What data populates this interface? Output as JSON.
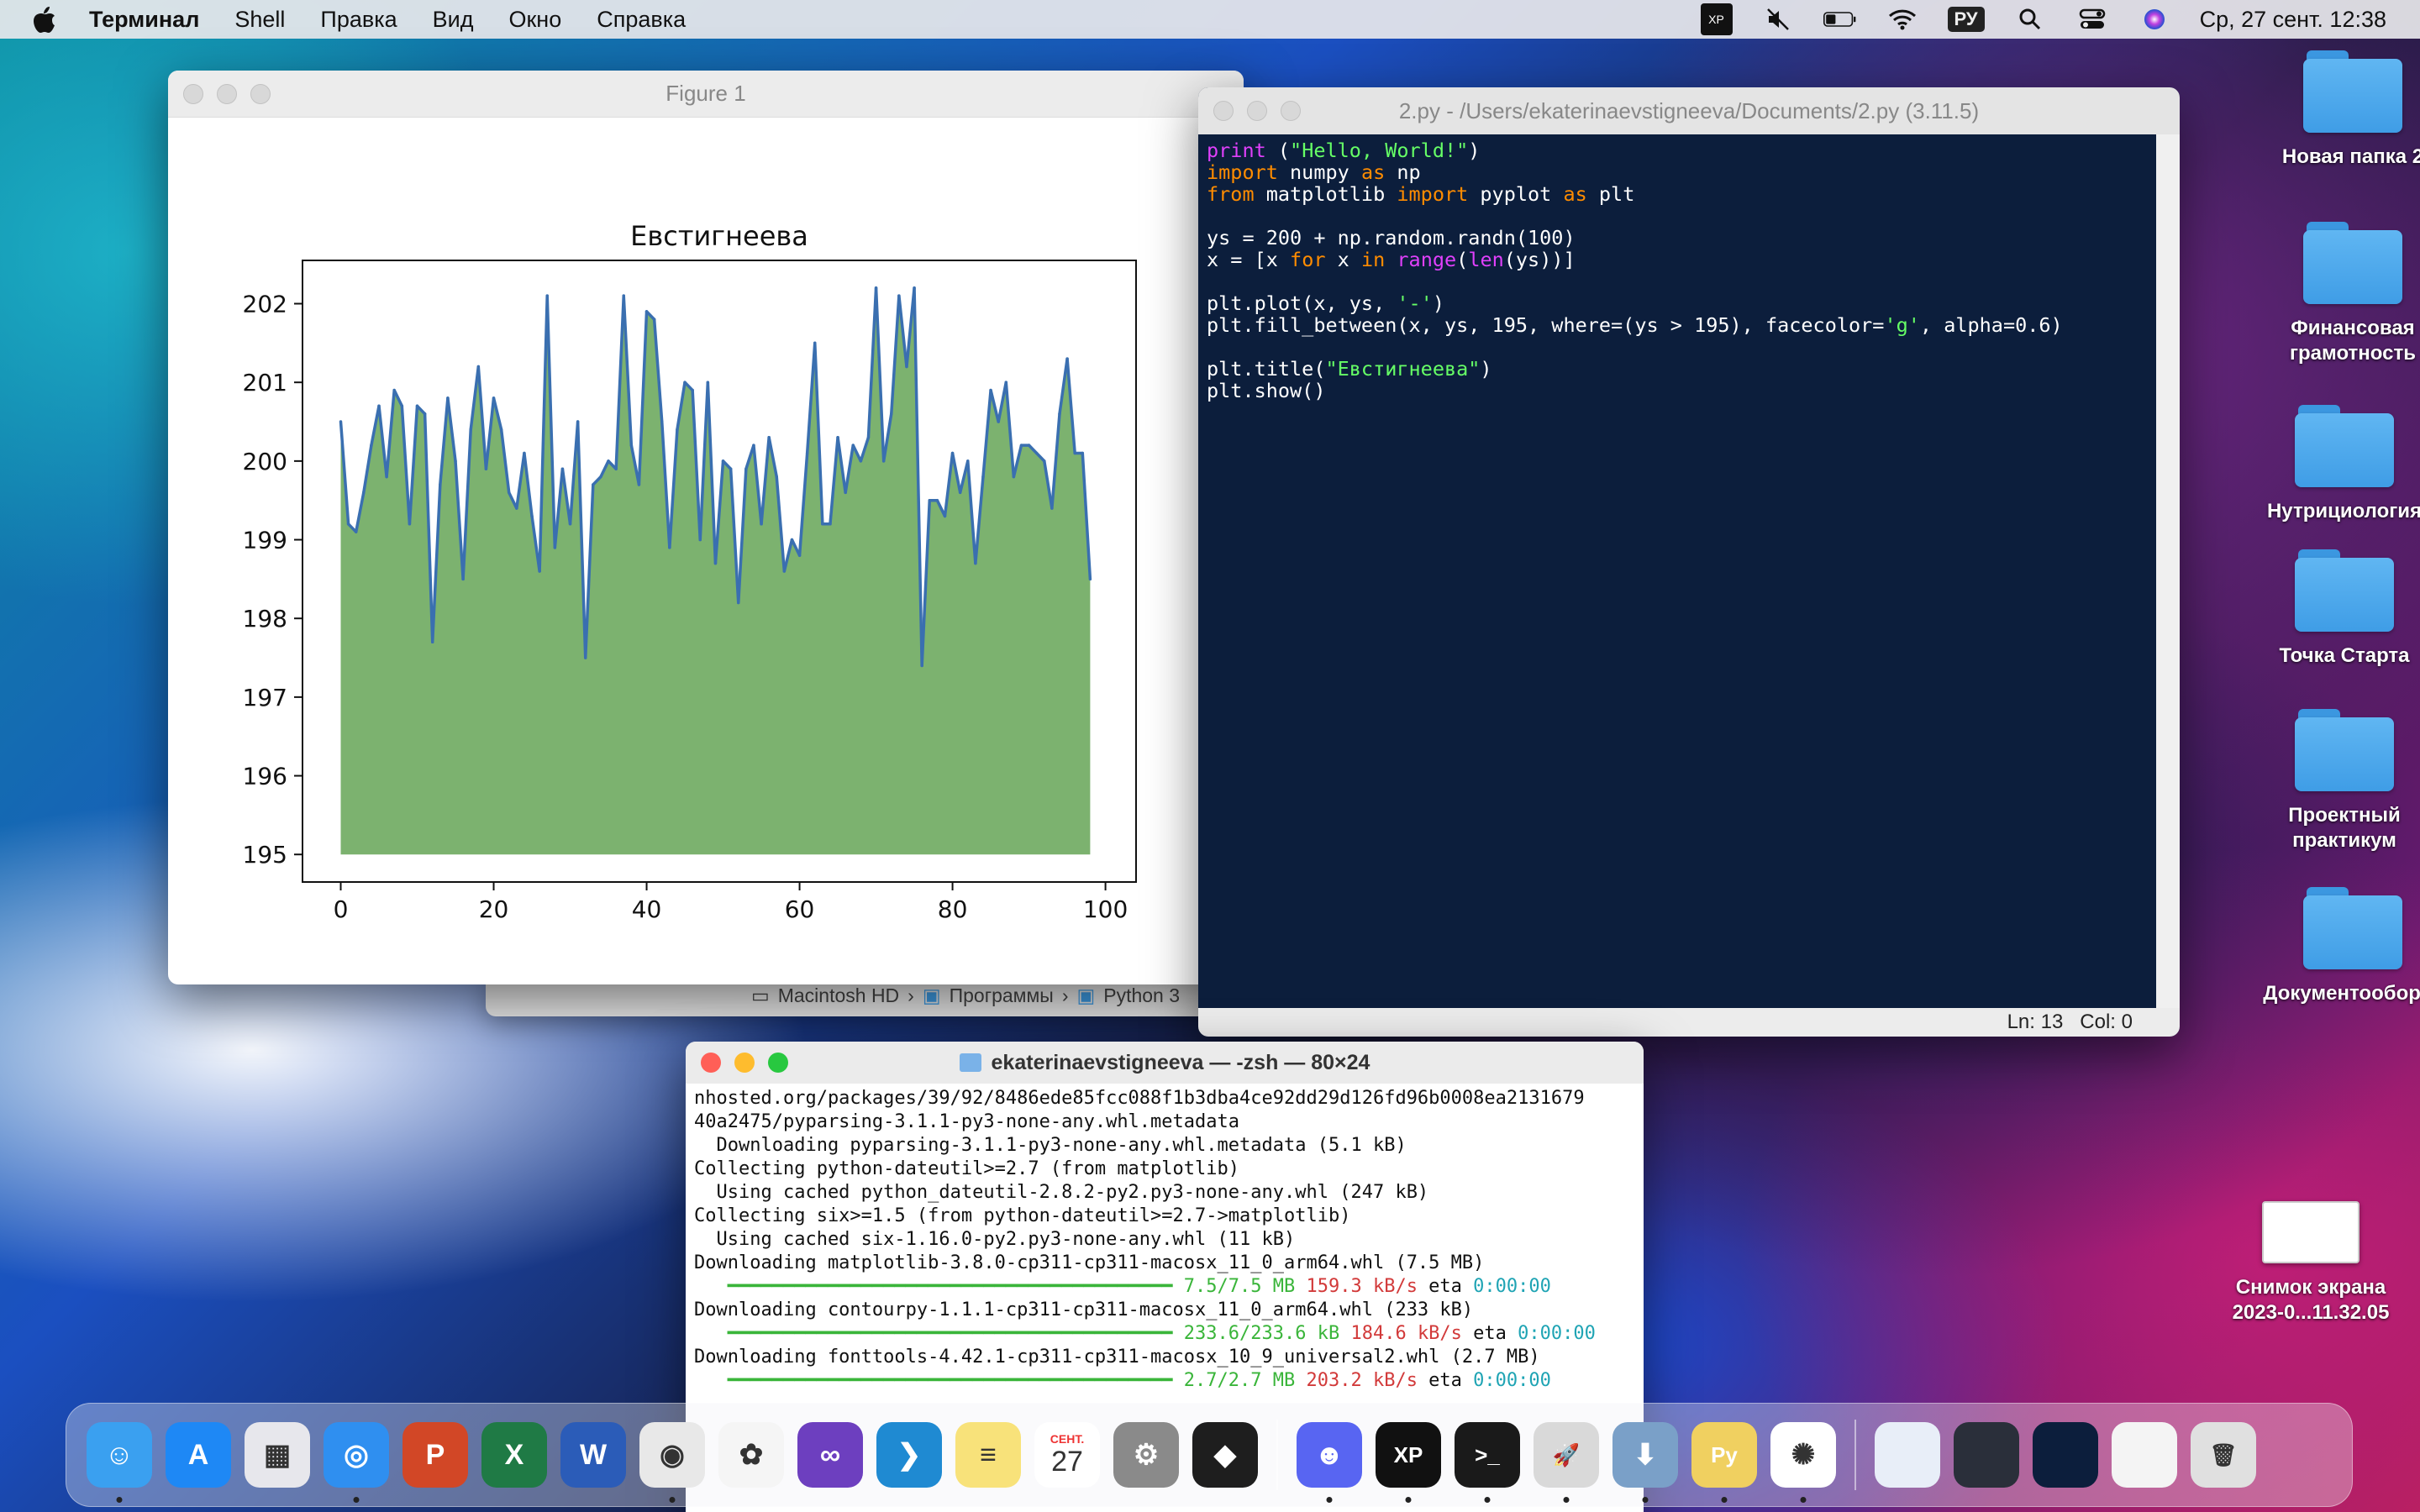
{
  "menubar": {
    "app_name": "Терминал",
    "items": [
      "Shell",
      "Правка",
      "Вид",
      "Окно",
      "Справка"
    ],
    "lang": "РУ",
    "clock": "Ср, 27 сент.  12:38"
  },
  "figure_window": {
    "title": "Figure 1",
    "toolbar": [
      "home-icon",
      "back-icon",
      "forward-icon",
      "pan-icon",
      "zoom-icon",
      "configure-icon",
      "save-icon"
    ]
  },
  "chart_data": {
    "type": "area",
    "title": "Евстигнеева",
    "xlabel": "",
    "ylabel": "",
    "xlim": [
      -5,
      104
    ],
    "ylim": [
      194.65,
      202.55
    ],
    "xticks": [
      0,
      20,
      40,
      60,
      80,
      100
    ],
    "yticks": [
      195,
      196,
      197,
      198,
      199,
      200,
      201,
      202
    ],
    "fill_baseline": 195,
    "fill_color": "#7cb26f",
    "line_color": "#3a6fb0",
    "x_start": 0,
    "y": [
      200.5,
      199.2,
      199.1,
      199.6,
      200.2,
      200.7,
      199.8,
      200.9,
      200.7,
      199.2,
      200.7,
      200.6,
      197.7,
      199.7,
      200.8,
      200.0,
      198.5,
      200.4,
      201.2,
      199.9,
      200.8,
      200.4,
      199.6,
      199.4,
      200.1,
      199.3,
      198.6,
      202.1,
      198.9,
      199.9,
      199.2,
      200.5,
      197.5,
      199.7,
      199.8,
      200.0,
      199.9,
      202.1,
      200.2,
      199.7,
      201.9,
      201.8,
      200.5,
      198.9,
      200.4,
      201.0,
      200.9,
      199.0,
      201.0,
      198.7,
      200.0,
      199.9,
      198.2,
      199.9,
      200.2,
      199.2,
      200.3,
      199.8,
      198.6,
      199.0,
      198.8,
      200.1,
      201.5,
      199.2,
      199.2,
      200.3,
      199.6,
      200.2,
      200.0,
      200.3,
      202.2,
      200.0,
      200.6,
      202.1,
      201.2,
      202.2,
      197.4,
      199.5,
      199.5,
      199.3,
      200.1,
      199.6,
      200.0,
      198.7,
      199.8,
      200.9,
      200.5,
      201.0,
      199.8,
      200.2,
      200.2,
      200.1,
      200.0,
      199.4,
      200.6,
      201.3,
      200.1,
      200.1,
      198.5
    ]
  },
  "finder": {
    "path": [
      "Macintosh HD",
      "Программы",
      "Python 3"
    ]
  },
  "editor": {
    "title": "2.py - /Users/ekaterinaevstigneeva/Documents/2.py (3.11.5)",
    "code": [
      [
        [
          "fn",
          "print"
        ],
        [
          "pl",
          " ("
        ],
        [
          "str",
          "\"Hello, World!\""
        ],
        [
          "pl",
          ")"
        ]
      ],
      [
        [
          "kw",
          "import"
        ],
        [
          "pl",
          " numpy "
        ],
        [
          "kw",
          "as"
        ],
        [
          "pl",
          " np"
        ]
      ],
      [
        [
          "kw",
          "from"
        ],
        [
          "pl",
          " matplotlib "
        ],
        [
          "kw",
          "import"
        ],
        [
          "pl",
          " pyplot "
        ],
        [
          "kw",
          "as"
        ],
        [
          "pl",
          " plt"
        ]
      ],
      [],
      [
        [
          "pl",
          "ys = 200 + np.random.randn(100)"
        ]
      ],
      [
        [
          "pl",
          "x = [x "
        ],
        [
          "kw",
          "for"
        ],
        [
          "pl",
          " x "
        ],
        [
          "kw",
          "in"
        ],
        [
          "pl",
          " "
        ],
        [
          "fn",
          "range"
        ],
        [
          "pl",
          "("
        ],
        [
          "fn",
          "len"
        ],
        [
          "pl",
          "(ys))]"
        ]
      ],
      [],
      [
        [
          "pl",
          "plt.plot(x, ys, "
        ],
        [
          "str",
          "'-'"
        ],
        [
          "pl",
          ")"
        ]
      ],
      [
        [
          "pl",
          "plt.fill_between(x, ys, 195, where=(ys > 195), facecolor="
        ],
        [
          "str",
          "'g'"
        ],
        [
          "pl",
          ", alpha=0.6)"
        ]
      ],
      [],
      [
        [
          "pl",
          "plt.title("
        ],
        [
          "str",
          "\"Евстигнеева\""
        ],
        [
          "pl",
          ")"
        ]
      ],
      [
        [
          "pl",
          "plt.show()"
        ]
      ]
    ],
    "status_line": "Ln: 13",
    "status_col": "Col: 0"
  },
  "terminal": {
    "title": "ekaterinaevstigneeva — -zsh — 80×24",
    "lines": [
      [
        [
          "",
          "nhosted.org/packages/39/92/8486ede85fcc088f1b3dba4ce92dd29d126fd96b0008ea2131679"
        ]
      ],
      [
        [
          "",
          "40a2475/pyparsing-3.1.1-py3-none-any.whl.metadata"
        ]
      ],
      [
        [
          "",
          "  Downloading pyparsing-3.1.1-py3-none-any.whl.metadata (5.1 kB)"
        ]
      ],
      [
        [
          "",
          "Collecting python-dateutil>=2.7 (from matplotlib)"
        ]
      ],
      [
        [
          "",
          "  Using cached python_dateutil-2.8.2-py2.py3-none-any.whl (247 kB)"
        ]
      ],
      [
        [
          "",
          "Collecting six>=1.5 (from python-dateutil>=2.7->matplotlib)"
        ]
      ],
      [
        [
          "",
          "  Using cached six-1.16.0-py2.py3-none-any.whl (11 kB)"
        ]
      ],
      [
        [
          "",
          "Downloading matplotlib-3.8.0-cp311-cp311-macosx_11_0_arm64.whl (7.5 MB)"
        ]
      ],
      [
        [
          "t-green",
          "   ━━━━━━━━━━━━━━━━━━━━━━━━━━━━━━━━━━━━━━━━ 7.5/7.5 MB "
        ],
        [
          "t-red",
          "159.3 kB/s"
        ],
        [
          "",
          " eta "
        ],
        [
          "t-cyan",
          "0:00:00"
        ]
      ],
      [
        [
          "",
          "Downloading contourpy-1.1.1-cp311-cp311-macosx_11_0_arm64.whl (233 kB)"
        ]
      ],
      [
        [
          "t-green",
          "   ━━━━━━━━━━━━━━━━━━━━━━━━━━━━━━━━━━━━━━━━ 233.6/233.6 kB "
        ],
        [
          "t-red",
          "184.6 kB/s"
        ],
        [
          "",
          " eta "
        ],
        [
          "t-cyan",
          "0:00:00"
        ]
      ],
      [
        [
          "",
          "Downloading fonttools-4.42.1-cp311-cp311-macosx_10_9_universal2.whl (2.7 MB)"
        ]
      ],
      [
        [
          "t-green",
          "   ━━━━━━━━━━━━━━━━━━━━━━━━━━━━━━━━━━━━━━━━ 2.7/2.7 MB "
        ],
        [
          "t-red",
          "203.2 kB/s"
        ],
        [
          "",
          " eta "
        ],
        [
          "t-cyan",
          "0:00:00"
        ]
      ]
    ]
  },
  "desktop_icons": [
    {
      "label": "Новая папка 2",
      "kind": "folder"
    },
    {
      "label": "Финансовая\nграмотность",
      "kind": "folder"
    },
    {
      "label": "Нутрициология",
      "kind": "folder"
    },
    {
      "label": "Точка Старта",
      "kind": "folder"
    },
    {
      "label": "Проектный\nпрактикум",
      "kind": "folder"
    },
    {
      "label": "Документооборот",
      "kind": "folder"
    },
    {
      "label": "Снимок экрана\n2023-0...11.32.05",
      "kind": "screenshot"
    }
  ],
  "dock": {
    "apps": [
      {
        "name": "finder",
        "color": "#3aa0f0",
        "glyph": "☺"
      },
      {
        "name": "app-store",
        "color": "#1e88f5",
        "glyph": "A"
      },
      {
        "name": "launchpad",
        "color": "#e7e7ec",
        "glyph": "▦"
      },
      {
        "name": "safari",
        "color": "#2f8ff0",
        "glyph": "◎"
      },
      {
        "name": "powerpoint",
        "color": "#d24726",
        "glyph": "P"
      },
      {
        "name": "excel",
        "color": "#1f7a45",
        "glyph": "X"
      },
      {
        "name": "word",
        "color": "#2b5cb8",
        "glyph": "W"
      },
      {
        "name": "chrome",
        "color": "#e8e8e8",
        "glyph": "◉"
      },
      {
        "name": "photos",
        "color": "#f5f5f5",
        "glyph": "✿"
      },
      {
        "name": "visual-studio",
        "color": "#6d3fbf",
        "glyph": "∞"
      },
      {
        "name": "vscode",
        "color": "#1f8ad2",
        "glyph": "❯"
      },
      {
        "name": "notes",
        "color": "#f8e27a",
        "glyph": "≡"
      },
      {
        "name": "calendar",
        "color": "#ffffff",
        "glyph": "27"
      },
      {
        "name": "system-settings",
        "color": "#8a8a8a",
        "glyph": "⚙"
      },
      {
        "name": "figma",
        "color": "#1e1e1e",
        "glyph": "◆"
      },
      {
        "name": "discord",
        "color": "#5865f2",
        "glyph": "☻"
      },
      {
        "name": "xp-pen",
        "color": "#111111",
        "glyph": "XP"
      },
      {
        "name": "terminal",
        "color": "#1a1a1a",
        "glyph": ">_"
      },
      {
        "name": "python-launcher",
        "color": "#d9d9d9",
        "glyph": "🚀"
      },
      {
        "name": "downloads",
        "color": "#7aa0c8",
        "glyph": "⬇"
      },
      {
        "name": "python-idle",
        "color": "#f0d060",
        "glyph": "Py"
      },
      {
        "name": "pinwheel",
        "color": "#ffffff",
        "glyph": "✺"
      },
      {
        "name": "window-preview-1",
        "color": "#e8eef8",
        "glyph": ""
      },
      {
        "name": "window-preview-2",
        "color": "#2a2f3a",
        "glyph": ""
      },
      {
        "name": "window-preview-3",
        "color": "#0c1e3c",
        "glyph": ""
      },
      {
        "name": "window-preview-4",
        "color": "#f4f4f4",
        "glyph": ""
      },
      {
        "name": "trash",
        "color": "#e0e0e0",
        "glyph": "🗑"
      }
    ],
    "calendar_month": "СЕНТ."
  }
}
